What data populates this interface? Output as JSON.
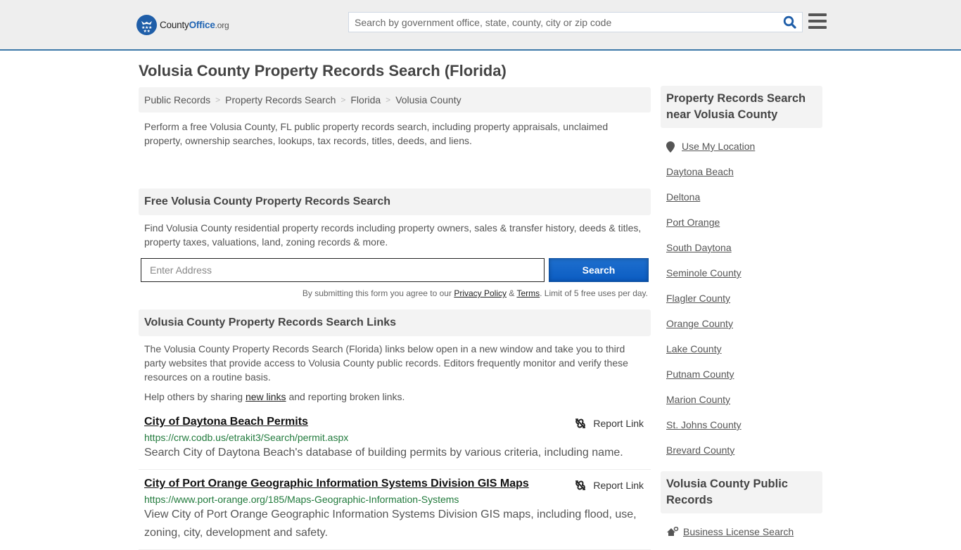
{
  "header": {
    "logo": {
      "prefix": "County",
      "brand": "Office",
      "tld": ".org"
    },
    "search_placeholder": "Search by government office, state, county, city or zip code",
    "accent_color": "#1f64b3",
    "border_color": "#3d78a8"
  },
  "page_title": "Volusia County Property Records Search (Florida)",
  "breadcrumb": [
    {
      "label": "Public Records"
    },
    {
      "label": "Property Records Search"
    },
    {
      "label": "Florida"
    },
    {
      "label": "Volusia County"
    }
  ],
  "intro": "Perform a free Volusia County, FL public property records search, including property appraisals, unclaimed property, ownership searches, lookups, tax records, titles, deeds, and liens.",
  "free_search": {
    "heading": "Free Volusia County Property Records Search",
    "description": "Find Volusia County residential property records including property owners, sales & transfer history, deeds & titles, property taxes, valuations, land, zoning records & more.",
    "address_placeholder": "Enter Address",
    "button_label": "Search",
    "disclaimer_prefix": "By submitting this form you agree to our ",
    "privacy_label": "Privacy Policy",
    "amp": " & ",
    "terms_label": "Terms",
    "disclaimer_suffix": ". Limit of 5 free uses per day."
  },
  "links_section": {
    "heading": "Volusia County Property Records Search Links",
    "intro": "The Volusia County Property Records Search (Florida) links below open in a new window and take you to third party websites that provide access to Volusia County public records. Editors frequently monitor and verify these resources on a routine basis.",
    "help_prefix": "Help others by sharing ",
    "help_link": "new links",
    "help_suffix": " and reporting broken links.",
    "report_label": "Report Link",
    "items": [
      {
        "title": "City of Daytona Beach Permits",
        "url": "https://crw.codb.us/etrakit3/Search/permit.aspx",
        "description": "Search City of Daytona Beach's database of building permits by various criteria, including name."
      },
      {
        "title": "City of Port Orange Geographic Information Systems Division GIS Maps",
        "url": "https://www.port-orange.org/185/Maps-Geographic-Information-Systems",
        "description": "View City of Port Orange Geographic Information Systems Division GIS maps, including flood, use, zoning, city, development and safety."
      }
    ]
  },
  "sidebar": {
    "nearby_heading": "Property Records Search near Volusia County",
    "use_location": "Use My Location",
    "nearby": [
      "Daytona Beach",
      "Deltona",
      "Port Orange",
      "South Daytona",
      "Seminole County",
      "Flagler County",
      "Orange County",
      "Lake County",
      "Putnam County",
      "Marion County",
      "St. Johns County",
      "Brevard County"
    ],
    "public_records_heading": "Volusia County Public Records",
    "public_records_items": [
      "Business License Search"
    ]
  }
}
